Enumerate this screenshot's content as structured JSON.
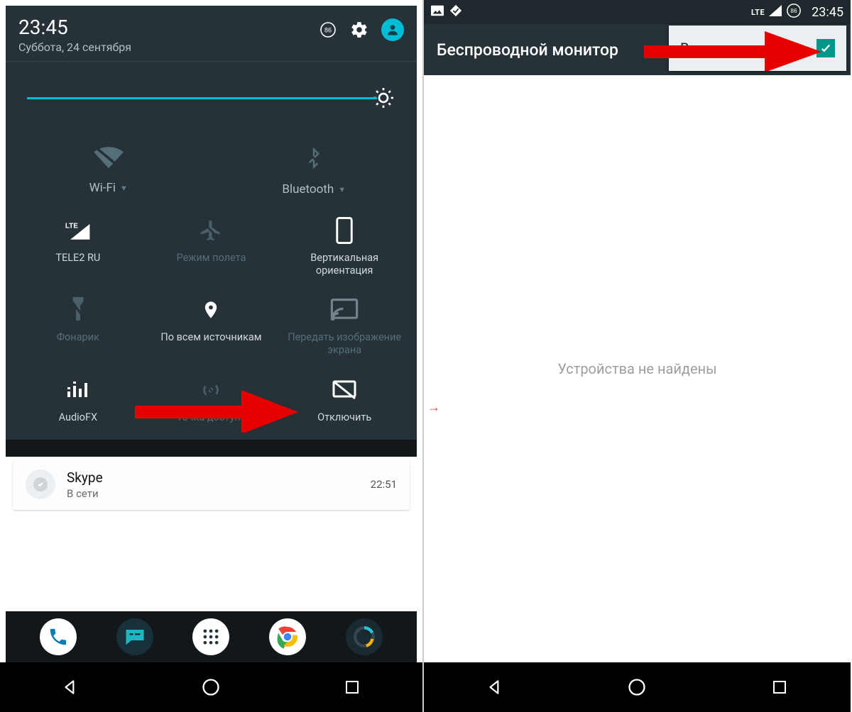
{
  "left": {
    "time": "23:45",
    "date": "Суббота, 24 сентября",
    "battery_badge": "86",
    "big_tiles": {
      "wifi": "Wi-Fi",
      "bluetooth": "Bluetooth"
    },
    "tiles": {
      "cell": "TELE2 RU",
      "airplane": "Режим полета",
      "rotation": "Вертикальная ориентация",
      "flashlight": "Фонарик",
      "location": "По всем источникам",
      "cast": "Передать изображение экрана",
      "audiofx": "AudioFX",
      "hotspot": "Точка доступа",
      "disable": "Отключить"
    },
    "notification": {
      "title": "Skype",
      "subtitle": "В сети",
      "time": "22:51"
    }
  },
  "right": {
    "status": {
      "lte": "LTE",
      "battery_badge": "86",
      "time": "23:45"
    },
    "appbar_title": "Беспроводной монитор",
    "enable_label": "Включить",
    "empty": "Устройства не найдены"
  }
}
